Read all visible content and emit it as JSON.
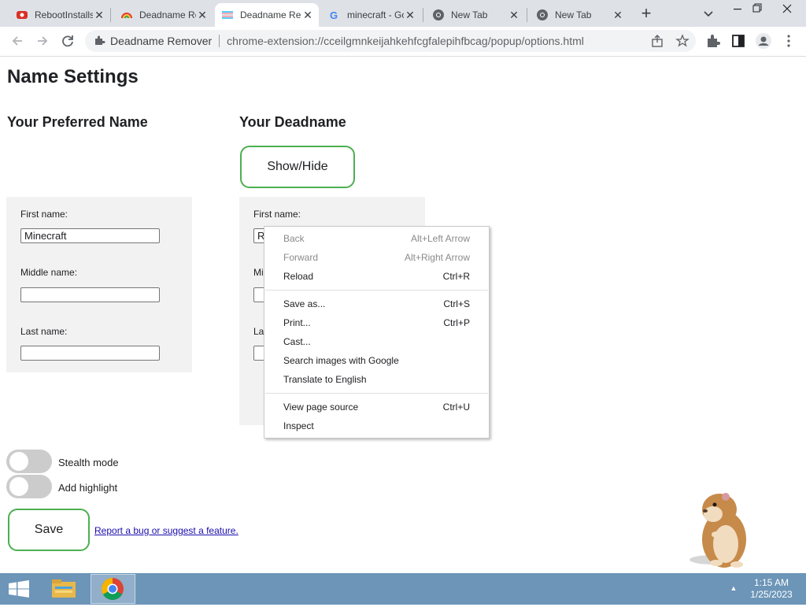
{
  "browser": {
    "tabs": [
      {
        "title": "RebootInstalls",
        "icon": "red-favicon-icon",
        "active": false
      },
      {
        "title": "Deadname Remover",
        "icon": "rainbow-favicon-icon",
        "active": false
      },
      {
        "title": "Deadname Remover",
        "icon": "trans-flag-favicon-icon",
        "active": true
      },
      {
        "title": "minecraft - Google Search",
        "icon": "google-favicon-icon",
        "active": false
      },
      {
        "title": "New Tab",
        "icon": "chrome-favicon-icon",
        "active": false
      },
      {
        "title": "New Tab",
        "icon": "chrome-favicon-icon",
        "active": false
      }
    ],
    "new_tab_symbol": "+",
    "tab_close_symbol": "✕",
    "site_label": "Deadname Remover",
    "url": "chrome-extension://cceilgmnkeijahkehfcgfalepihfbcag/popup/options.html"
  },
  "page": {
    "title": "Name Settings",
    "preferred_heading": "Your Preferred Name",
    "deadname_heading": "Your Deadname",
    "show_hide_label": "Show/Hide",
    "preferred": {
      "first_label": "First name:",
      "first_value": "Minecraft",
      "middle_label": "Middle name:",
      "middle_value": "",
      "last_label": "Last name:",
      "last_value": ""
    },
    "deadname": {
      "first_label": "First name:",
      "first_value": "R",
      "middle_label_partial": "Mi",
      "last_label_partial": "La"
    },
    "stealth_label": "Stealth mode",
    "stealth_on": false,
    "highlight_label": "Add highlight",
    "highlight_on": false,
    "save_label": "Save",
    "report_link": "Report a bug or suggest a feature."
  },
  "context_menu": {
    "groups": [
      [
        {
          "label": "Back",
          "shortcut": "Alt+Left Arrow",
          "disabled": true
        },
        {
          "label": "Forward",
          "shortcut": "Alt+Right Arrow",
          "disabled": true
        },
        {
          "label": "Reload",
          "shortcut": "Ctrl+R",
          "disabled": false
        }
      ],
      [
        {
          "label": "Save as...",
          "shortcut": "Ctrl+S",
          "disabled": false
        },
        {
          "label": "Print...",
          "shortcut": "Ctrl+P",
          "disabled": false
        },
        {
          "label": "Cast...",
          "shortcut": "",
          "disabled": false
        },
        {
          "label": "Search images with Google",
          "shortcut": "",
          "disabled": false
        },
        {
          "label": "Translate to English",
          "shortcut": "",
          "disabled": false
        }
      ],
      [
        {
          "label": "View page source",
          "shortcut": "Ctrl+U",
          "disabled": false
        },
        {
          "label": "Inspect",
          "shortcut": "",
          "disabled": false
        }
      ]
    ]
  },
  "taskbar": {
    "time": "1:15 AM",
    "date": "1/25/2023",
    "tray_arrow": "▲"
  },
  "colors": {
    "tabstrip": "#dee1e6",
    "accent_green": "#4caf50",
    "panel": "#f2f2f2",
    "taskbar": "#6c95b8"
  }
}
